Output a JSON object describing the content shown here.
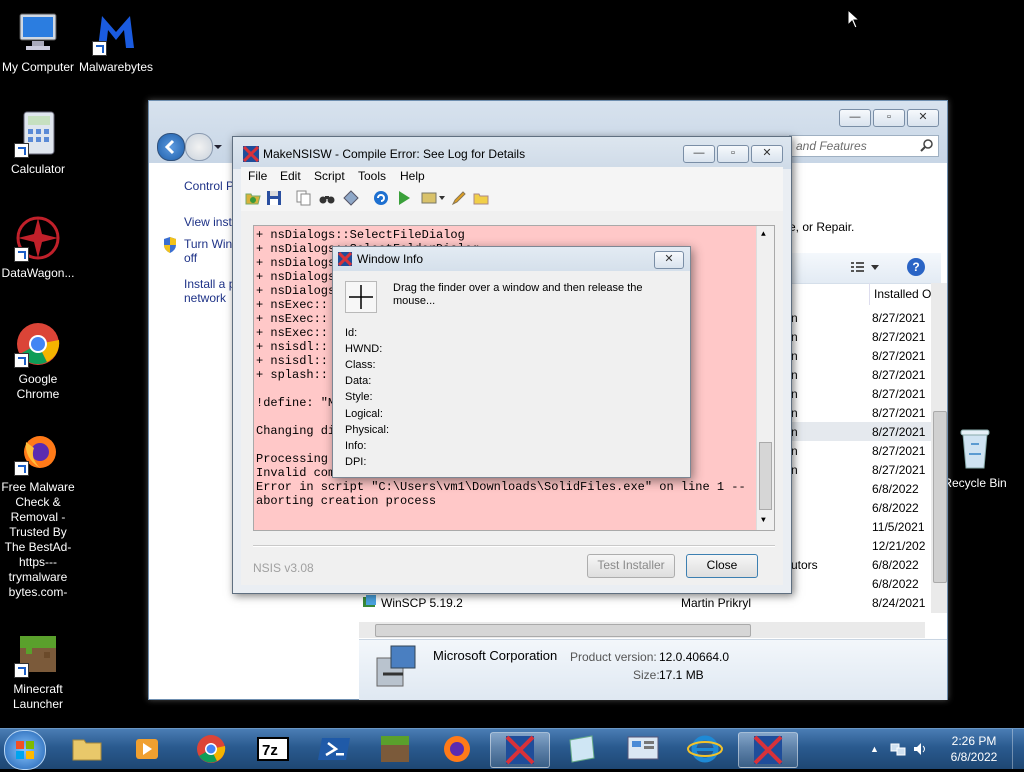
{
  "desktop": {
    "icons": [
      {
        "label": "My Computer"
      },
      {
        "label": "Malwarebytes"
      },
      {
        "label": "Calculator"
      },
      {
        "label": "DataWagon..."
      },
      {
        "label": "Google Chrome"
      },
      {
        "label": "Free Malware Check & Removal - Trusted By The BestAd-https---trymalware bytes.com-"
      },
      {
        "label": "Minecraft Launcher"
      },
      {
        "label": "Recycle Bin"
      }
    ]
  },
  "control_panel": {
    "search_placeholder": "and Features",
    "left_links": [
      "Control P",
      "View inst",
      "Turn Win off",
      "Install a p network"
    ],
    "uninstall_hint": "e, or Repair.",
    "column_installed": "Installed O",
    "rows": [
      {
        "publisher": "n",
        "date": "8/27/2021"
      },
      {
        "publisher": "n",
        "date": "8/27/2021"
      },
      {
        "publisher": "n",
        "date": "8/27/2021"
      },
      {
        "publisher": "n",
        "date": "8/27/2021"
      },
      {
        "publisher": "n",
        "date": "8/27/2021"
      },
      {
        "publisher": "n",
        "date": "8/27/2021"
      },
      {
        "publisher": "n",
        "date": "8/27/2021"
      },
      {
        "publisher": "n",
        "date": "8/27/2021"
      },
      {
        "publisher": "n",
        "date": "8/27/2021"
      },
      {
        "publisher": "",
        "date": "6/8/2022"
      },
      {
        "publisher": "",
        "date": "6/8/2022"
      },
      {
        "publisher": "",
        "date": "11/5/2021"
      },
      {
        "publisher": "",
        "date": "12/21/202"
      },
      {
        "publisher": "utors",
        "date": "6/8/2022"
      },
      {
        "publisher": "",
        "date": "6/8/2022"
      }
    ],
    "last_row": {
      "name": "WinSCP 5.19.2",
      "publisher": "Martin Prikryl",
      "date": "8/24/2021"
    },
    "details": {
      "company": "Microsoft Corporation",
      "product_version_label": "Product version:",
      "product_version": "12.0.40664.0",
      "size_label": "Size:",
      "size": "17.1 MB"
    }
  },
  "nsis": {
    "title": "MakeNSISW - Compile Error: See Log for Details",
    "menu": [
      "File",
      "Edit",
      "Script",
      "Tools",
      "Help"
    ],
    "log_lines": [
      "+ nsDialogs::SelectFileDialog",
      "+ nsDialogs::SelectFolderDialog",
      "+ nsDialogs::",
      "+ nsDialogs::",
      "+ nsDialogs::",
      "+ nsExec::",
      "+ nsExec::",
      "+ nsExec::",
      "+ nsisdl::",
      "+ nsisdl::",
      "+ splash::",
      "",
      "!define: \"M",
      "",
      "Changing di",
      "",
      "Processing                                          \" (ACP)",
      "Invalid com",
      "Error in script \"C:\\Users\\vm1\\Downloads\\SolidFiles.exe\" on line 1 --",
      "aborting creation process"
    ],
    "version": "NSIS v3.08",
    "test_button": "Test Installer",
    "close_button": "Close"
  },
  "window_info": {
    "title": "Window Info",
    "instruction": "Drag the finder over a window and then release the mouse...",
    "fields": [
      "Id:",
      "HWND:",
      "Class:",
      "Data:",
      "Style:",
      "Logical:",
      "Physical:",
      "Info:",
      "DPI:"
    ]
  },
  "taskbar": {
    "time": "2:26 PM",
    "date": "6/8/2022"
  }
}
